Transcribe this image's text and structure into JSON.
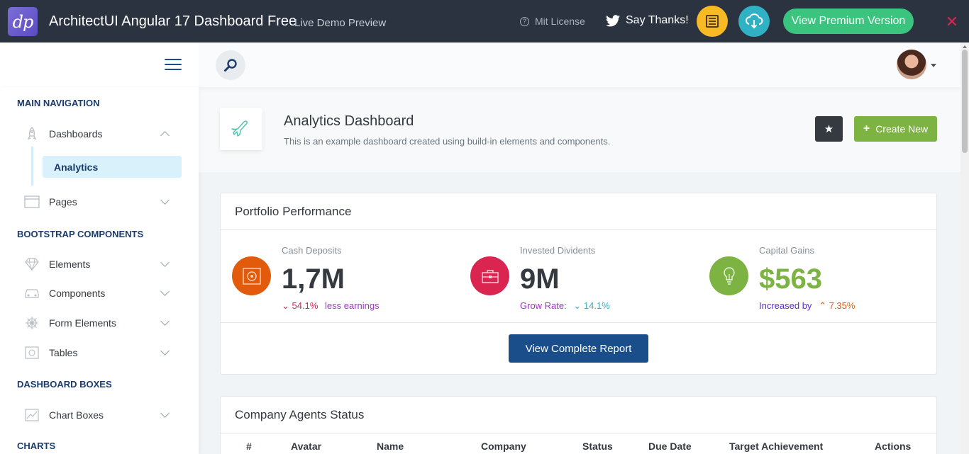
{
  "demobar": {
    "logo_text": "dp",
    "title": "ArchitectUI Angular 17 Dashboard Free",
    "subtitle": "Live Demo Preview",
    "license": "Mit License",
    "thanks": "Say Thanks!",
    "premium": "View Premium Version",
    "close": "✕",
    "colors": {
      "bar": "#2b3340",
      "premium": "#3ac47d",
      "yellow": "#f7b924",
      "teal": "#30b1c4"
    }
  },
  "sidebar": {
    "sections": {
      "main": "MAIN NAVIGATION",
      "bootstrap": "BOOTSTRAP COMPONENTS",
      "boxes": "DASHBOARD BOXES",
      "charts": "CHARTS"
    },
    "items": {
      "dashboards": "Dashboards",
      "analytics": "Analytics",
      "pages": "Pages",
      "elements": "Elements",
      "components": "Components",
      "form_elements": "Form Elements",
      "tables": "Tables",
      "chart_boxes": "Chart Boxes"
    }
  },
  "page": {
    "title": "Analytics Dashboard",
    "subtitle": "This is an example dashboard created using build-in elements and components.",
    "create_button": "Create New"
  },
  "portfolio": {
    "title": "Portfolio Performance",
    "widgets": [
      {
        "label": "Cash Deposits",
        "value": "1,7M",
        "foot_pct": "54.1%",
        "foot_text": "less earnings"
      },
      {
        "label": "Invested Dividents",
        "value": "9M",
        "foot_text": "Grow Rate:",
        "foot_pct": "14.1%"
      },
      {
        "label": "Capital Gains",
        "value": "$563",
        "foot_text": "Increased by",
        "foot_pct": "7.35%"
      }
    ],
    "button": "View Complete Report"
  },
  "agents": {
    "title": "Company Agents Status",
    "columns": [
      "#",
      "Avatar",
      "Name",
      "Company",
      "Status",
      "Due Date",
      "Target Achievement",
      "Actions"
    ]
  }
}
